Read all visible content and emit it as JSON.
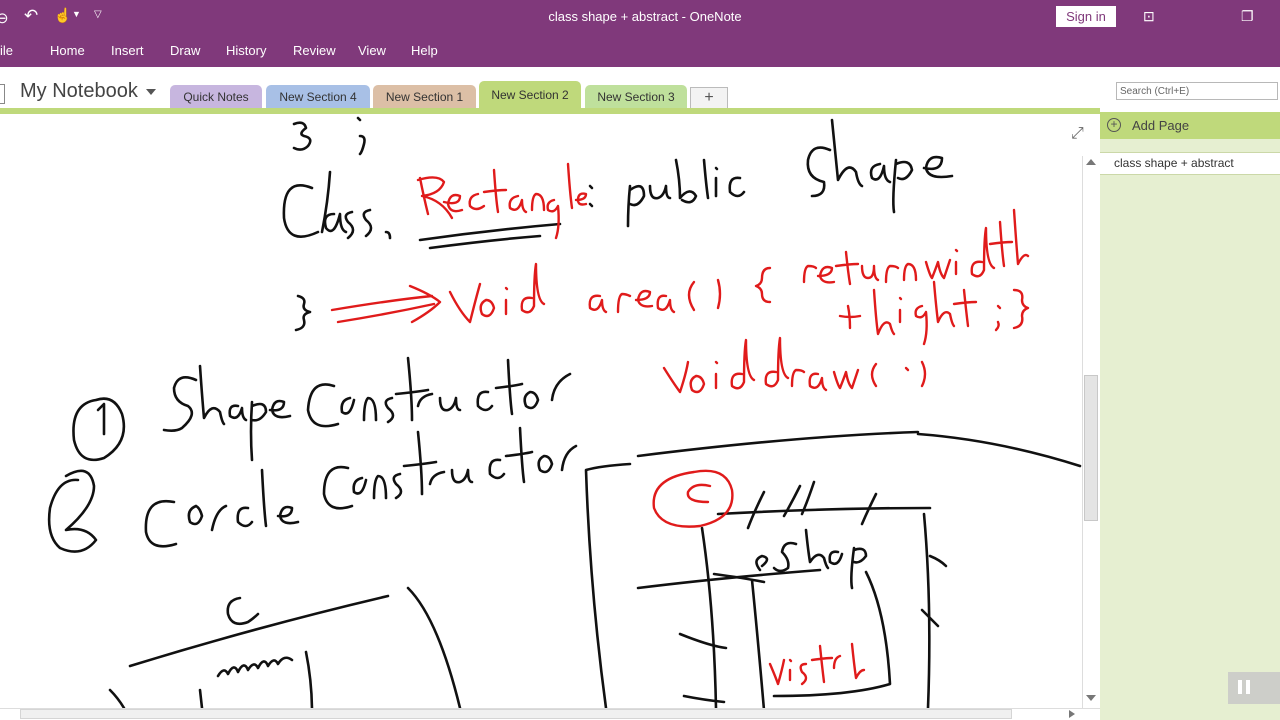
{
  "window": {
    "title": "class shape + abstract  -  OneNote",
    "sign_in": "Sign in",
    "back_menu_partial": "ile"
  },
  "ribbon_tabs": [
    "Home",
    "Insert",
    "Draw",
    "History",
    "Review",
    "View",
    "Help"
  ],
  "notebook": {
    "name": "My Notebook"
  },
  "sections": [
    {
      "label": "Quick Notes",
      "color": "#c7b6df",
      "active": false
    },
    {
      "label": "New Section 4",
      "color": "#a8c0e6",
      "active": false
    },
    {
      "label": "New Section 1",
      "color": "#dcbfa6",
      "active": false
    },
    {
      "label": "New Section 2",
      "color": "#bfd97b",
      "active": true
    },
    {
      "label": "New Section 3",
      "color": "#bfe09c",
      "active": false
    }
  ],
  "add_section_label": "+",
  "search": {
    "placeholder": "Search (Ctrl+E)"
  },
  "page_pane": {
    "add_page_label": "Add Page",
    "pages": [
      "class shape + abstract"
    ]
  },
  "theme": {
    "accent": "#80397b",
    "section_green": "#bfd97b",
    "ink_black": "#111111",
    "ink_red": "#e01b1b"
  }
}
